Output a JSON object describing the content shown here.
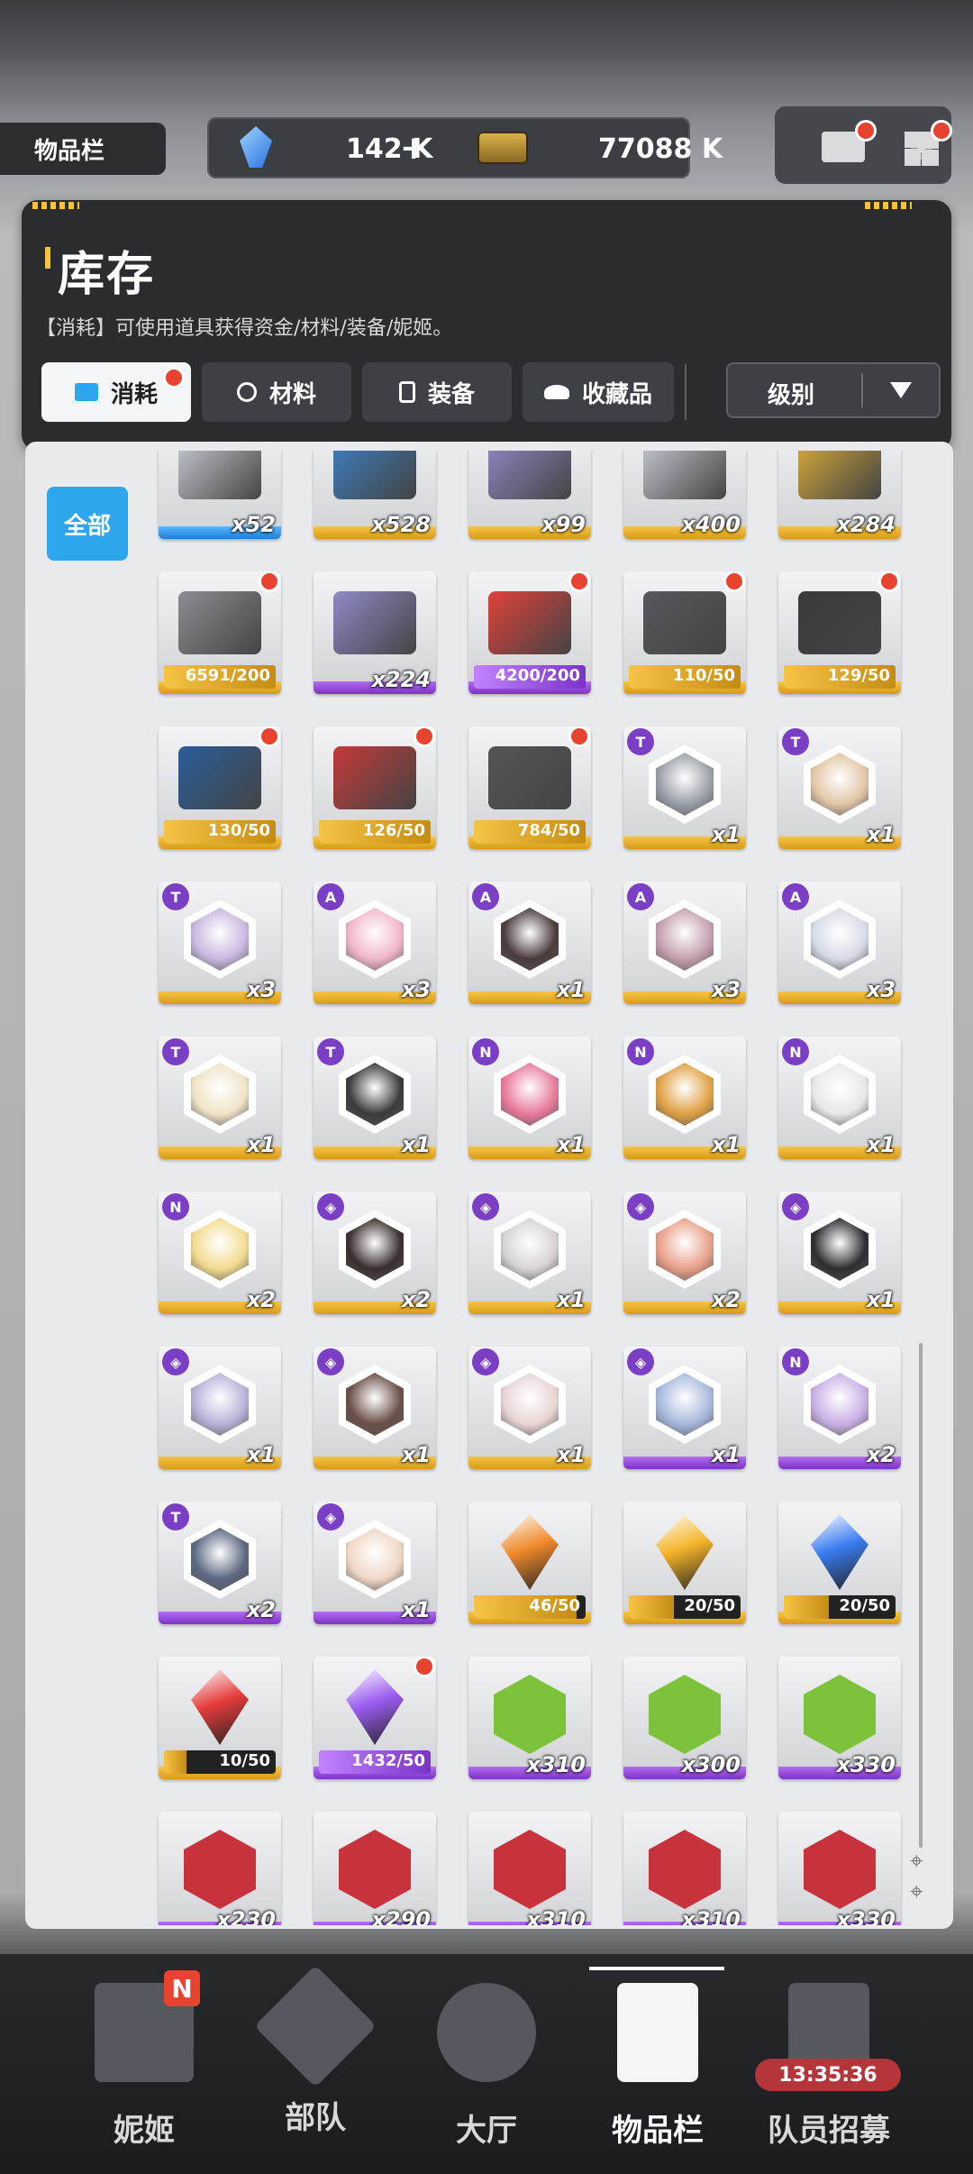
{
  "top": {
    "section_label": "物品栏",
    "gems": "142 K",
    "gems_plus": "+",
    "credits": "77088 K"
  },
  "header": {
    "title": "库存",
    "subtitle": "【消耗】可使用道具获得资金/材料/装备/妮姬。",
    "tabs": [
      {
        "label": "消耗",
        "icon": "consumable-icon",
        "active": true
      },
      {
        "label": "材料",
        "icon": "material-icon",
        "active": false
      },
      {
        "label": "装备",
        "icon": "equipment-icon",
        "active": false
      },
      {
        "label": "收藏品",
        "icon": "collection-icon",
        "active": false
      }
    ],
    "sort_label": "级别",
    "filter_all": "全部"
  },
  "items": [
    [
      {
        "type": "box",
        "color": "#c7ccd4",
        "qty": "x52",
        "band": "blue"
      },
      {
        "type": "box",
        "color": "#3d7fc2",
        "qty": "x528",
        "band": "gold"
      },
      {
        "type": "box",
        "color": "#8e8ac7",
        "qty": "x99",
        "band": "gold"
      },
      {
        "type": "box",
        "color": "#c7ccd4",
        "qty": "x400",
        "band": "gold"
      },
      {
        "type": "box",
        "color": "#d9ac3a",
        "qty": "x284",
        "band": "gold"
      }
    ],
    [
      {
        "type": "box",
        "color": "#8a8d93",
        "prog": "6591/200",
        "fill": 1,
        "band": "gold",
        "dot": true
      },
      {
        "type": "box",
        "color": "#8e8ac7",
        "qty": "x224",
        "band": "purple",
        "dot": false
      },
      {
        "type": "box",
        "color": "#e0413b",
        "prog": "4200/200",
        "fill": 1,
        "band": "purple",
        "dot": true
      },
      {
        "type": "box",
        "color": "#55585e",
        "prog": "110/50",
        "fill": 1,
        "band": "gold",
        "dot": true
      },
      {
        "type": "box",
        "color": "#3a3a3a",
        "prog": "129/50",
        "fill": 1,
        "band": "gold",
        "dot": true
      }
    ],
    [
      {
        "type": "box",
        "color": "#2a5d9a",
        "prog": "130/50",
        "fill": 1,
        "band": "gold",
        "dot": true
      },
      {
        "type": "box",
        "color": "#c43a3a",
        "prog": "126/50",
        "fill": 1,
        "band": "gold",
        "dot": true
      },
      {
        "type": "box",
        "color": "#555",
        "prog": "784/50",
        "fill": 1,
        "band": "gold",
        "dot": true
      },
      {
        "type": "hex",
        "color": "#9aa0a8",
        "qty": "x1",
        "band": "gold",
        "badge": "T"
      },
      {
        "type": "hex",
        "color": "#e3c7a8",
        "qty": "x1",
        "band": "gold",
        "badge": "T"
      }
    ],
    [
      {
        "type": "hex",
        "color": "#c9b8e0",
        "qty": "x3",
        "band": "gold",
        "badge": "T"
      },
      {
        "type": "hex",
        "color": "#f2b7c9",
        "qty": "x3",
        "band": "gold",
        "badge": "A"
      },
      {
        "type": "hex",
        "color": "#4b3b3b",
        "qty": "x1",
        "band": "gold",
        "badge": "A"
      },
      {
        "type": "hex",
        "color": "#c4a0b0",
        "qty": "x3",
        "band": "gold",
        "badge": "A"
      },
      {
        "type": "hex",
        "color": "#d7dbe6",
        "qty": "x3",
        "band": "gold",
        "badge": "A"
      }
    ],
    [
      {
        "type": "hex",
        "color": "#f0e4c8",
        "qty": "x1",
        "band": "gold",
        "badge": "T"
      },
      {
        "type": "hex",
        "color": "#3b3b3b",
        "qty": "x1",
        "band": "gold",
        "badge": "T"
      },
      {
        "type": "hex",
        "color": "#e87a9a",
        "qty": "x1",
        "band": "gold",
        "badge": "N"
      },
      {
        "type": "hex",
        "color": "#e0a145",
        "qty": "x1",
        "band": "gold",
        "badge": "N"
      },
      {
        "type": "hex",
        "color": "#e8e8ea",
        "qty": "x1",
        "band": "gold",
        "badge": "N"
      }
    ],
    [
      {
        "type": "hex",
        "color": "#f3dc90",
        "qty": "x2",
        "band": "gold",
        "badge": "N"
      },
      {
        "type": "hex",
        "color": "#3a2e2e",
        "qty": "x2",
        "band": "gold",
        "badge": "◈"
      },
      {
        "type": "hex",
        "color": "#d8d2d6",
        "qty": "x1",
        "band": "gold",
        "badge": "◈"
      },
      {
        "type": "hex",
        "color": "#e9a08a",
        "qty": "x2",
        "band": "gold",
        "badge": "◈"
      },
      {
        "type": "hex",
        "color": "#2e2e32",
        "qty": "x1",
        "band": "gold",
        "badge": "◈"
      }
    ],
    [
      {
        "type": "hex",
        "color": "#b7b3d8",
        "qty": "x1",
        "band": "gold",
        "badge": "◈"
      },
      {
        "type": "hex",
        "color": "#6b5048",
        "qty": "x1",
        "band": "gold",
        "badge": "◈"
      },
      {
        "type": "hex",
        "color": "#e8d5d5",
        "qty": "x1",
        "band": "gold",
        "badge": "◈"
      },
      {
        "type": "hex",
        "color": "#a7b9dc",
        "qty": "x1",
        "band": "purple",
        "badge": "◈"
      },
      {
        "type": "hex",
        "color": "#c9b0e6",
        "qty": "x2",
        "band": "purple",
        "badge": "N"
      }
    ],
    [
      {
        "type": "hex",
        "color": "#5c6780",
        "qty": "x2",
        "band": "purple",
        "badge": "T"
      },
      {
        "type": "hex",
        "color": "#f0d7c6",
        "qty": "x1",
        "band": "purple",
        "badge": "◈"
      },
      {
        "type": "crys",
        "color": "#f08a2c",
        "prog": "46/50",
        "fill": 0.92,
        "band": "gold"
      },
      {
        "type": "crys",
        "color": "#f5b52a",
        "prog": "20/50",
        "fill": 0.4,
        "band": "gold"
      },
      {
        "type": "crys",
        "color": "#3a7cf0",
        "prog": "20/50",
        "fill": 0.4,
        "band": "gold"
      }
    ],
    [
      {
        "type": "crys",
        "color": "#e53b3b",
        "prog": "10/50",
        "fill": 0.2,
        "band": "gold"
      },
      {
        "type": "crys",
        "color": "#9a5cf0",
        "prog": "1432/50",
        "fill": 1,
        "band": "purple",
        "dot": true
      },
      {
        "type": "hexgreen",
        "color": "#7cc23a",
        "qty": "x310",
        "band": "purple"
      },
      {
        "type": "hexgreen",
        "color": "#7cc23a",
        "qty": "x300",
        "band": "purple"
      },
      {
        "type": "hexgreen",
        "color": "#7cc23a",
        "qty": "x330",
        "band": "purple"
      }
    ],
    [
      {
        "type": "hexgreen",
        "color": "#c8323c",
        "qty": "x230",
        "band": "purple"
      },
      {
        "type": "hexgreen",
        "color": "#c8323c",
        "qty": "x290",
        "band": "purple"
      },
      {
        "type": "hexgreen",
        "color": "#c8323c",
        "qty": "x310",
        "band": "purple"
      },
      {
        "type": "hexgreen",
        "color": "#c8323c",
        "qty": "x310",
        "band": "purple"
      },
      {
        "type": "hexgreen",
        "color": "#c8323c",
        "qty": "x330",
        "band": "purple"
      }
    ]
  ],
  "nav": [
    {
      "label": "妮姬",
      "icon": "nikke-icon",
      "badge": "N"
    },
    {
      "label": "部队",
      "icon": "squad-icon"
    },
    {
      "label": "大厅",
      "icon": "lobby-icon"
    },
    {
      "label": "物品栏",
      "icon": "inventory-icon",
      "active": true
    },
    {
      "label": "队员招募",
      "icon": "recruit-icon",
      "timer": "13:35:36"
    }
  ]
}
